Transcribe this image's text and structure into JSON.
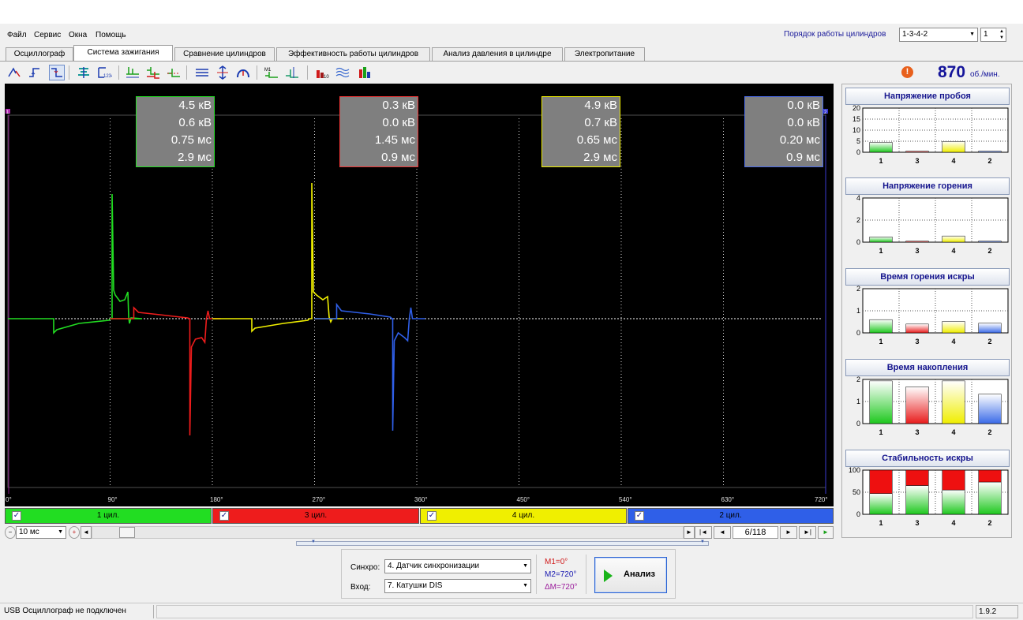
{
  "menu": [
    "Файл",
    "Сервис",
    "Окна",
    "Помощь"
  ],
  "cylinder_order": {
    "label": "Порядок работы цилиндров",
    "value": "1-3-4-2",
    "spin_value": "1"
  },
  "tabs": [
    "Осциллограф",
    "Система зажигания",
    "Сравнение цилиндров",
    "Эффективность работы цилиндров",
    "Анализ давления в цилиндре",
    "Электропитание"
  ],
  "active_tab": "Система зажигания",
  "toolbar_icons": [
    "cursor-icon",
    "rising-edge-icon",
    "falling-edge-icon",
    "tree-icon",
    "export-icon",
    "secondary-ignition-icon",
    "multi-trace-icon",
    "single-trace-icon",
    "parade-icon",
    "raster-icon",
    "display-icon",
    "scale-icon",
    "marker-icon",
    "bar-chart-red-icon",
    "waves-icon",
    "bar-chart-green-icon"
  ],
  "rpm": {
    "value": "870",
    "unit": "об./мин."
  },
  "colors": {
    "cyl1": "#22dd22",
    "cyl3": "#ee1c1c",
    "cyl4": "#f0ef00",
    "cyl2": "#2f5fe8"
  },
  "info_boxes": [
    {
      "cylinder": "1",
      "lines": [
        "4.5 кВ",
        "0.6 кВ",
        "0.75 мс",
        "2.9 мс"
      ]
    },
    {
      "cylinder": "3",
      "lines": [
        "0.3 кВ",
        "0.0 кВ",
        "1.45 мс",
        "0.9 мс"
      ]
    },
    {
      "cylinder": "4",
      "lines": [
        "4.9 кВ",
        "0.7 кВ",
        "0.65 мс",
        "2.9 мс"
      ]
    },
    {
      "cylinder": "2",
      "lines": [
        "0.0 кВ",
        "0.0 кВ",
        "0.20 мс",
        "0.9 мс"
      ]
    }
  ],
  "scope": {
    "marker_left": "1",
    "marker_right": "2",
    "x_ticks": [
      "0°",
      "90°",
      "180°",
      "270°",
      "360°",
      "450°",
      "540°",
      "630°",
      "720°"
    ]
  },
  "channels": [
    {
      "label": "1 цил.",
      "checked": true
    },
    {
      "label": "3 цил.",
      "checked": true
    },
    {
      "label": "4 цил.",
      "checked": true
    },
    {
      "label": "2 цил.",
      "checked": true
    }
  ],
  "timebase": {
    "value": "10 мс"
  },
  "page_counter": "6/118",
  "right_panel": [
    {
      "title": "Напряжение пробоя",
      "yticks": [
        "20",
        "15",
        "10",
        "5",
        "0"
      ],
      "ymax": 20,
      "values": [
        4.5,
        0.3,
        4.9,
        0.0
      ],
      "categories": [
        "1",
        "3",
        "4",
        "2"
      ]
    },
    {
      "title": "Напряжение горения",
      "yticks": [
        "4",
        "2",
        "0"
      ],
      "ymax": 5,
      "values": [
        0.6,
        0.0,
        0.7,
        0.0
      ],
      "categories": [
        "1",
        "3",
        "4",
        "2"
      ]
    },
    {
      "title": "Время горения искры",
      "yticks": [
        "2",
        "1",
        "0"
      ],
      "ymax": 2.5,
      "values": [
        0.75,
        0.5,
        0.65,
        0.55
      ],
      "categories": [
        "1",
        "3",
        "4",
        "2"
      ]
    },
    {
      "title": "Время накопления",
      "yticks": [
        "2",
        "1",
        "0"
      ],
      "ymax": 3,
      "values": [
        2.9,
        2.5,
        2.9,
        2.0
      ],
      "categories": [
        "1",
        "3",
        "4",
        "2"
      ]
    },
    {
      "title": "Стабильность искры",
      "yticks": [
        "100",
        "50",
        "0"
      ],
      "ymax": 100,
      "stacked": true,
      "green": [
        47,
        65,
        55,
        73
      ],
      "categories": [
        "1",
        "3",
        "4",
        "2"
      ]
    }
  ],
  "sync": {
    "label": "Синхро:",
    "value": "4.  Датчик синхронизации"
  },
  "input": {
    "label": "Вход:",
    "value": "7.  Катушки DIS"
  },
  "markers": {
    "m1": "M1=0°",
    "m2": "M2=720°",
    "dm": "ΔM=720°"
  },
  "analyze_label": "Анализ",
  "status": {
    "text": "USB Осциллограф не подключен",
    "version": "1.9.2"
  }
}
